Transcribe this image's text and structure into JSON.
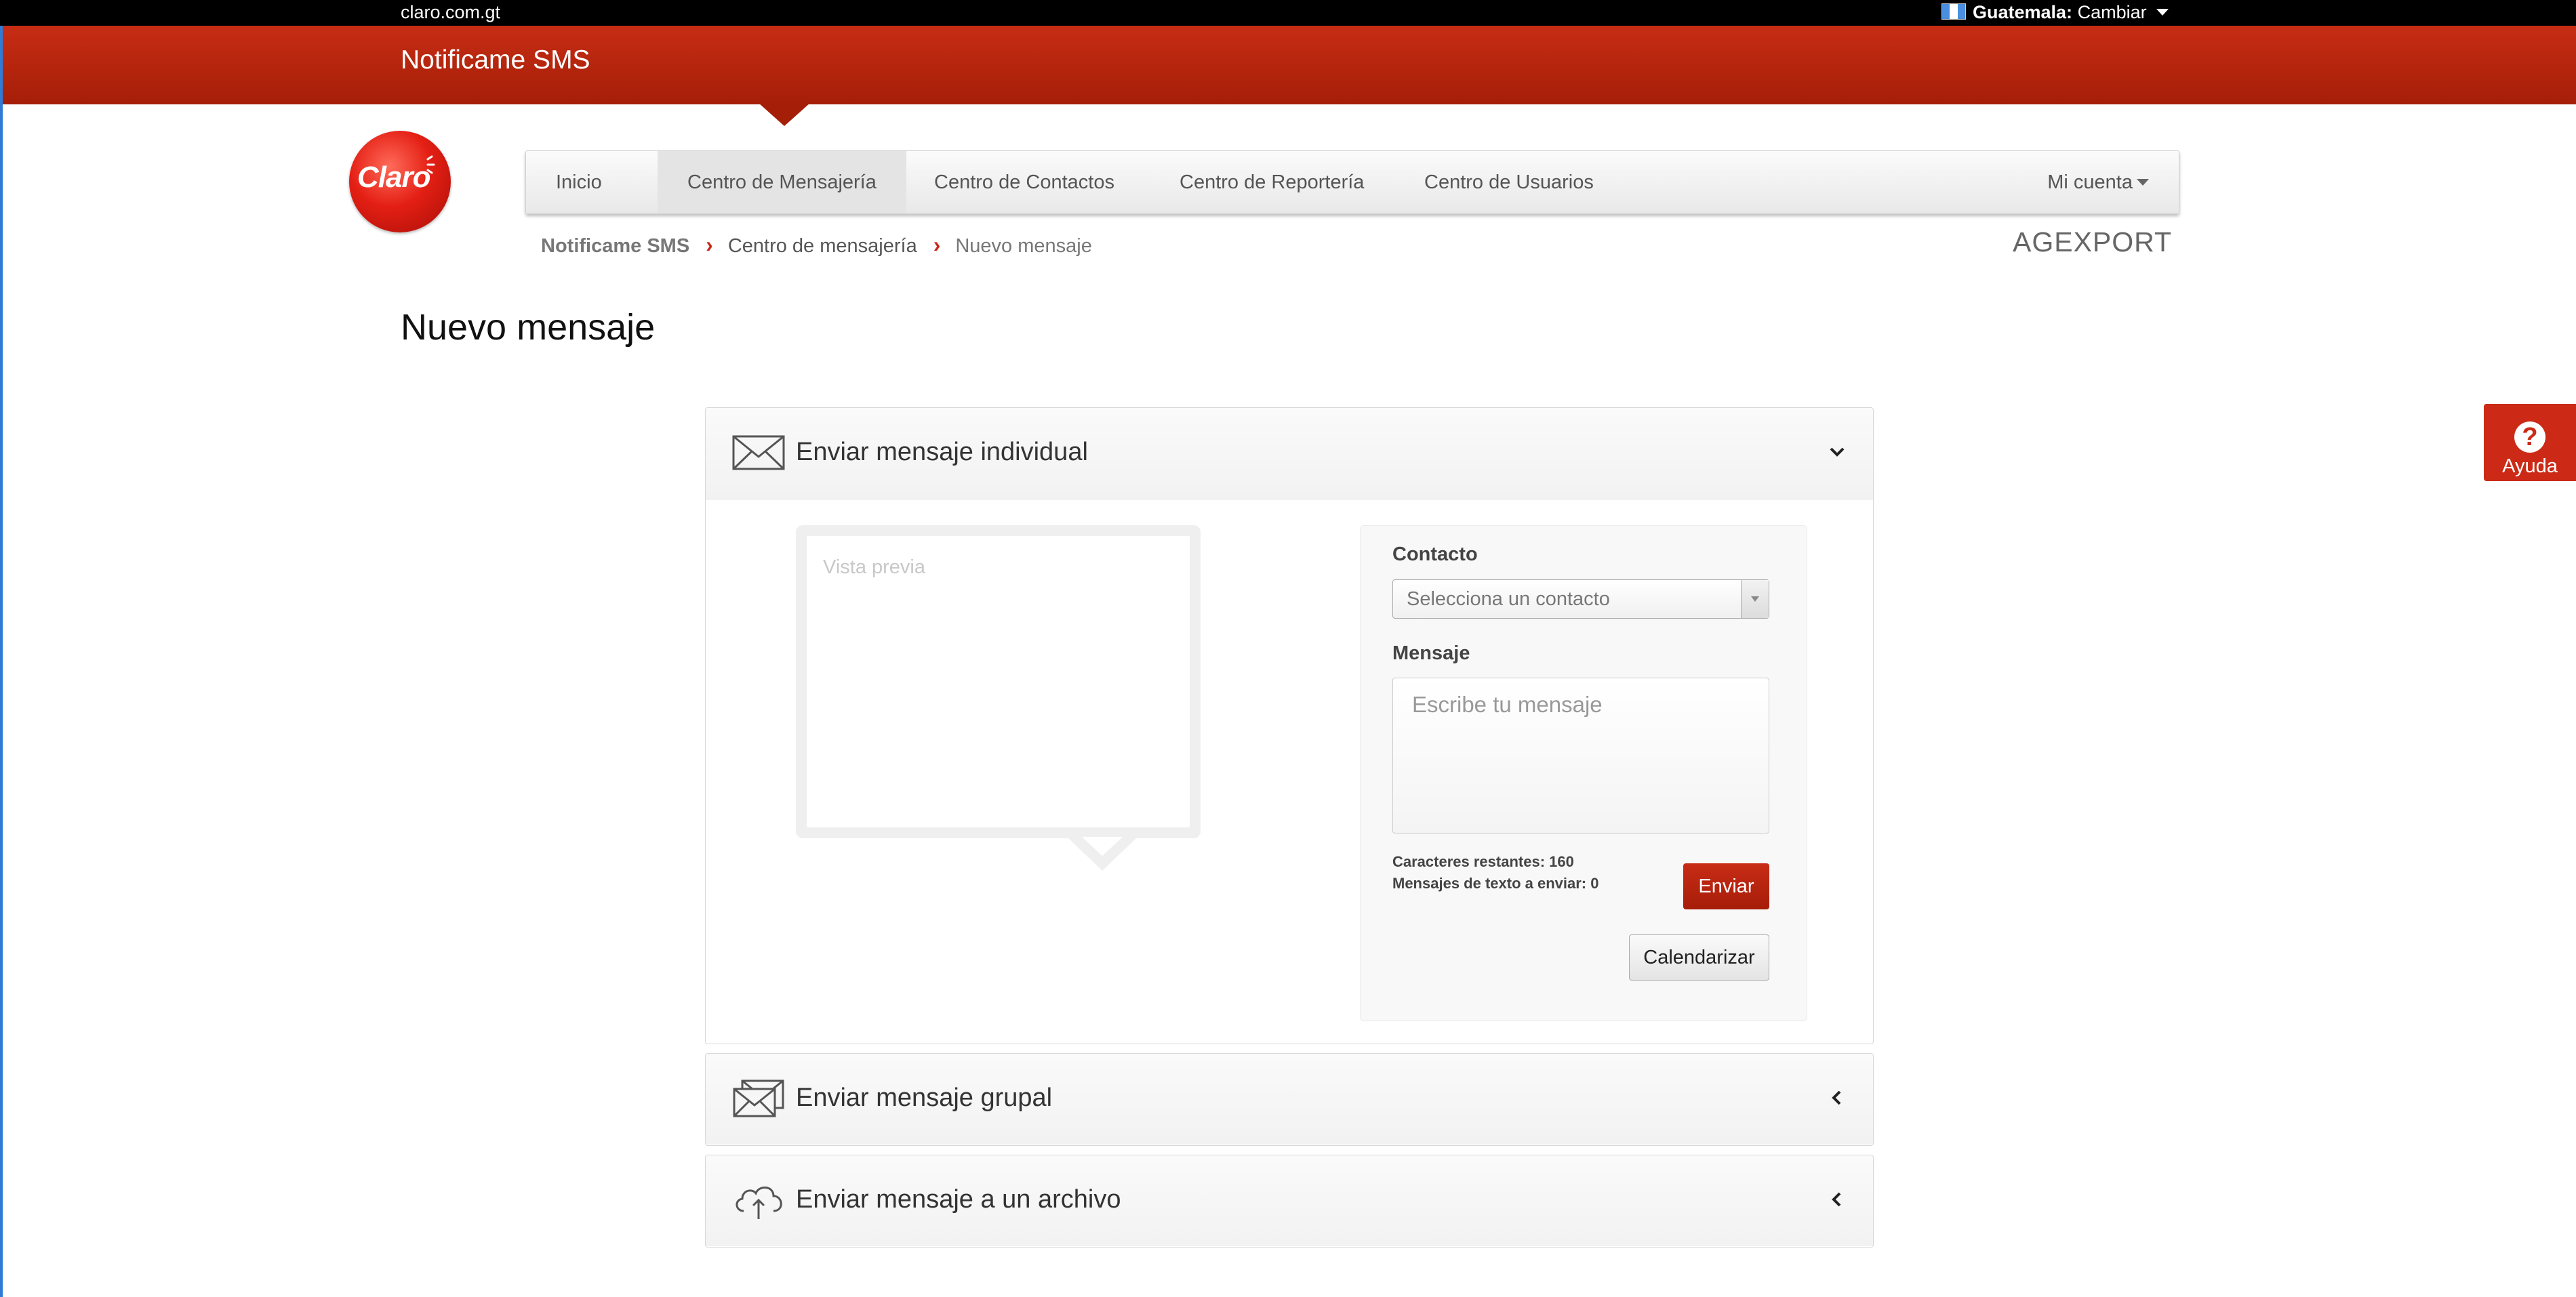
{
  "topbar": {
    "site_link": "claro.com.gt",
    "country_label": "Guatemala:",
    "country_change": "Cambiar"
  },
  "header": {
    "title": "Notificame SMS"
  },
  "logo": {
    "text": "Claro"
  },
  "nav": {
    "items": [
      {
        "label": "Inicio"
      },
      {
        "label": "Centro de Mensajería",
        "active": true
      },
      {
        "label": "Centro de Contactos"
      },
      {
        "label": "Centro de Reportería"
      },
      {
        "label": "Centro de Usuarios"
      }
    ],
    "account": "Mi cuenta"
  },
  "breadcrumb": {
    "root": "Notificame SMS",
    "section": "Centro de mensajería",
    "current": "Nuevo mensaje"
  },
  "organization": "AGEXPORT",
  "page": {
    "title": "Nuevo mensaje"
  },
  "help": {
    "label": "Ayuda"
  },
  "panels": {
    "individual": {
      "title": "Enviar mensaje individual",
      "icon": "envelope-icon"
    },
    "group": {
      "title": "Enviar mensaje grupal",
      "icon": "envelopes-icon"
    },
    "file": {
      "title": "Enviar mensaje a un archivo",
      "icon": "cloud-upload-icon"
    }
  },
  "preview": {
    "placeholder": "Vista previa"
  },
  "form": {
    "contact_label": "Contacto",
    "contact_placeholder": "Selecciona un contacto",
    "message_label": "Mensaje",
    "message_placeholder": "Escribe tu mensaje",
    "chars_remaining": "Caracteres restantes: 160",
    "messages_to_send": "Mensajes de texto a enviar: 0",
    "send_label": "Enviar",
    "schedule_label": "Calendarizar"
  },
  "colors": {
    "brand_red": "#c72d14",
    "topbar": "#000000",
    "accent_blue": "#2f7bd6"
  }
}
